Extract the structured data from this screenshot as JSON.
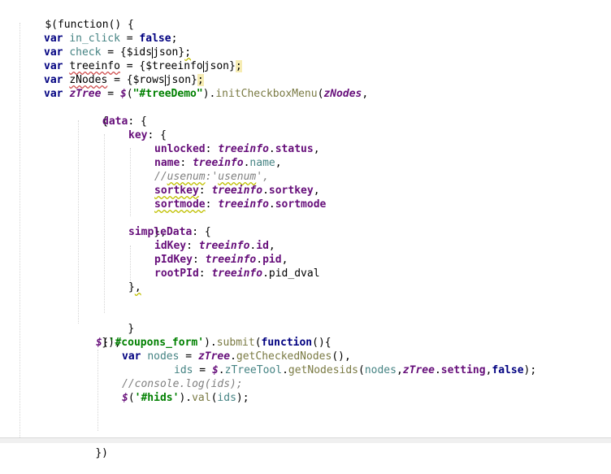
{
  "editor": {
    "lines": [
      "$(function() {",
      "",
      "var in_click = false;",
      "var check = {$ids|json};",
      "var treeinfo = {$treeinfo|json};",
      "var zNodes = {$rows|json};",
      "var zTree = $(\"#treeDemo\").initCheckboxMenu(zNodes,",
      "{",
      "data: {",
      "key: {",
      "unlocked: treeinfo.status,",
      "name: treeinfo.name,",
      "//usenum:'usenum',",
      "sortkey: treeinfo.sortkey,",
      "sortmode: treeinfo.sortmode",
      "},",
      "simpleData: {",
      "idKey: treeinfo.id,",
      "pIdKey: treeinfo.pid,",
      "rootPId: treeinfo.pid_dval",
      "},",
      "",
      "}",
      "});",
      "$('#coupons_form').submit(function(){",
      "var nodes = zTree.getCheckedNodes(),",
      "ids = $.zTreeTool.getNodesids(nodes,zTree.setting,false);",
      "//console.log(ids);",
      "$('#hids').val(ids);",
      "",
      "",
      "",
      "})"
    ]
  }
}
